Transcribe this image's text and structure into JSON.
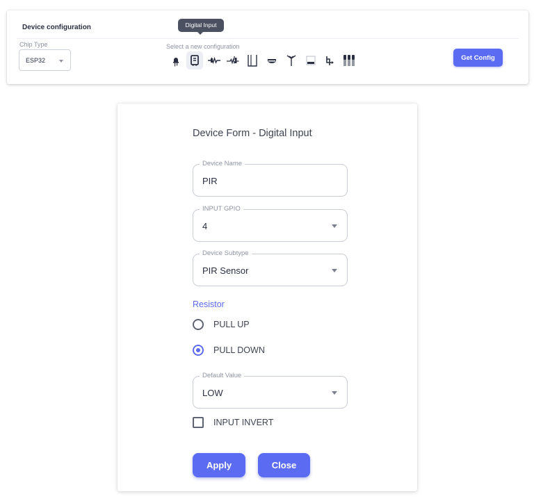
{
  "config": {
    "title": "Device configuration",
    "chip_type_label": "Chip Type",
    "chip_type_value": "ESP32",
    "select_label": "Select a new configuration",
    "tooltip": "Digital Input",
    "get_config_label": "Get Config",
    "icons": [
      "led-icon",
      "digital-input-icon",
      "resistor-icon",
      "potentiometer-icon",
      "relay-contact-icon",
      "buzzer-icon",
      "antenna-icon",
      "display-module-icon",
      "servo-icon",
      "transistor-pair-icon"
    ],
    "selected_icon": "digital-input-icon"
  },
  "form": {
    "title": "Device Form - Digital Input",
    "device_name": {
      "label": "Device Name",
      "value": "PIR"
    },
    "input_gpio": {
      "label": "INPUT GPIO",
      "value": "4"
    },
    "device_subtype": {
      "label": "Device Subtype",
      "value": "PIR Sensor"
    },
    "resistor": {
      "label": "Resistor",
      "options": [
        {
          "label": "PULL UP",
          "checked": false
        },
        {
          "label": "PULL DOWN",
          "checked": true
        }
      ]
    },
    "default_value": {
      "label": "Default Value",
      "value": "LOW"
    },
    "input_invert": {
      "label": "INPUT INVERT",
      "checked": false
    },
    "apply_label": "Apply",
    "close_label": "Close"
  },
  "colors": {
    "accent": "#5b6cf2",
    "tooltip_bg": "#4b5160",
    "text": "#2a3042",
    "muted": "#8d93a1"
  }
}
